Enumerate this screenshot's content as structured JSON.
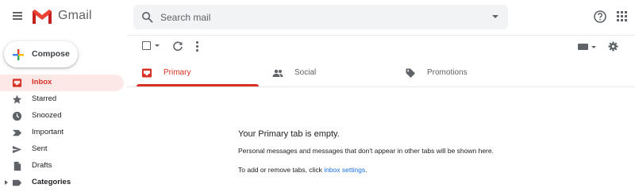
{
  "header": {
    "brand": "Gmail",
    "search_placeholder": "Search mail"
  },
  "compose_label": "Compose",
  "nav": [
    {
      "label": "Inbox",
      "icon": "inbox-icon",
      "active": true
    },
    {
      "label": "Starred",
      "icon": "star-icon"
    },
    {
      "label": "Snoozed",
      "icon": "clock-icon"
    },
    {
      "label": "Important",
      "icon": "important-icon"
    },
    {
      "label": "Sent",
      "icon": "send-icon"
    },
    {
      "label": "Drafts",
      "icon": "draft-icon"
    },
    {
      "label": "Categories",
      "icon": "label-icon",
      "bold": true
    }
  ],
  "tabs": [
    {
      "label": "Primary",
      "icon": "inbox-icon",
      "active": true
    },
    {
      "label": "Social",
      "icon": "people-icon"
    },
    {
      "label": "Promotions",
      "icon": "tag-icon"
    }
  ],
  "empty_state": {
    "title": "Your Primary tab is empty.",
    "description": "Personal messages and messages that don't appear in other tabs will be shown here.",
    "tip_prefix": "To add or remove tabs, click ",
    "tip_link": "inbox settings",
    "tip_suffix": "."
  },
  "colors": {
    "accent_red": "#d93025",
    "active_bg": "#fce8e6",
    "link_blue": "#1a73e8",
    "search_bg": "#f1f3f4"
  }
}
